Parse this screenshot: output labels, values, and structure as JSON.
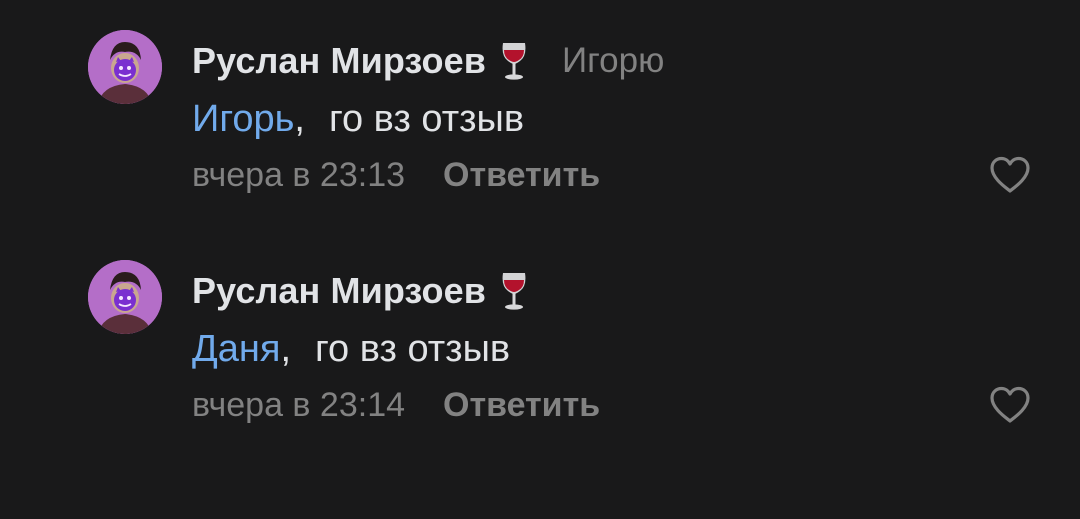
{
  "comments": [
    {
      "author": "Руслан Мирзоев",
      "author_emoji": "wine-glass-icon",
      "reply_to": "Игорю",
      "mention": "Игорь",
      "comma": ",",
      "text": "го вз отзыв",
      "time": "вчера в 23:13",
      "reply_label": "Ответить"
    },
    {
      "author": "Руслан Мирзоев",
      "author_emoji": "wine-glass-icon",
      "reply_to": "",
      "mention": "Даня",
      "comma": ",",
      "text": "го вз отзыв",
      "time": "вчера в 23:14",
      "reply_label": "Ответить"
    }
  ],
  "colors": {
    "background": "#19191a",
    "text_primary": "#e1e3e6",
    "text_secondary": "#828282",
    "mention": "#71aaeb",
    "avatar_bg": "#b46ec8"
  }
}
